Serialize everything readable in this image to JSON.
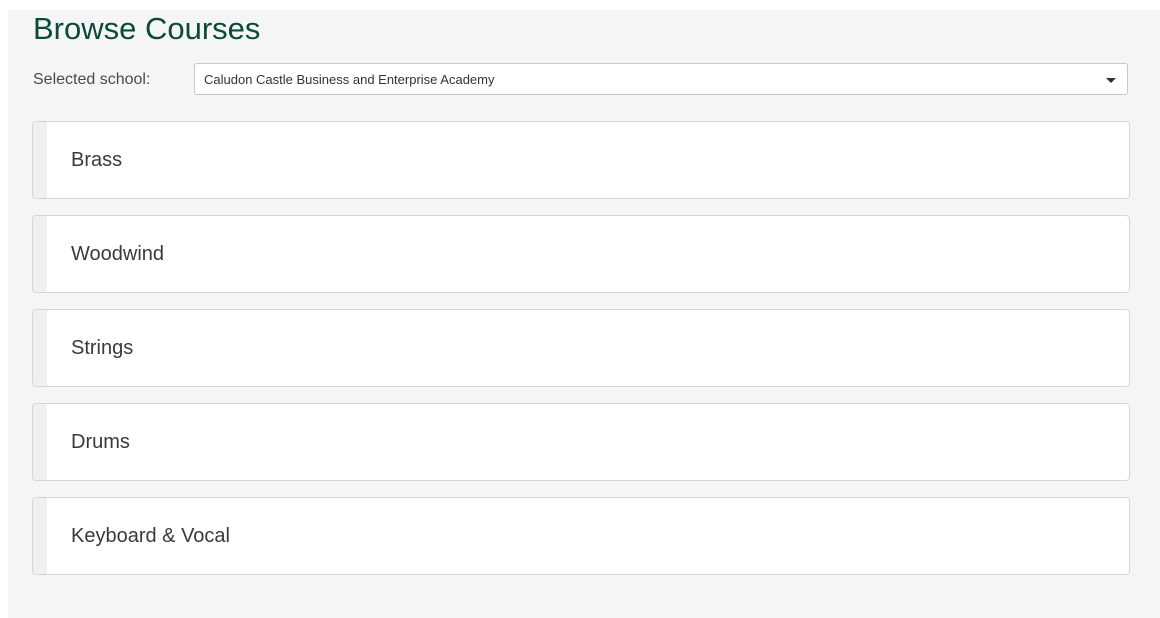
{
  "page": {
    "title": "Browse Courses"
  },
  "school_selector": {
    "label": "Selected school:",
    "selected_value": "Caludon Castle Business and Enterprise Academy"
  },
  "courses": [
    {
      "label": "Brass"
    },
    {
      "label": "Woodwind"
    },
    {
      "label": "Strings"
    },
    {
      "label": "Drums"
    },
    {
      "label": "Keyboard & Vocal"
    }
  ],
  "colors": {
    "title": "#0c4a3c",
    "panel_background": "#f5f5f5",
    "card_background": "#ffffff",
    "card_border": "#d6d6d6"
  },
  "icons": {
    "select_caret": "caret-down-icon"
  }
}
